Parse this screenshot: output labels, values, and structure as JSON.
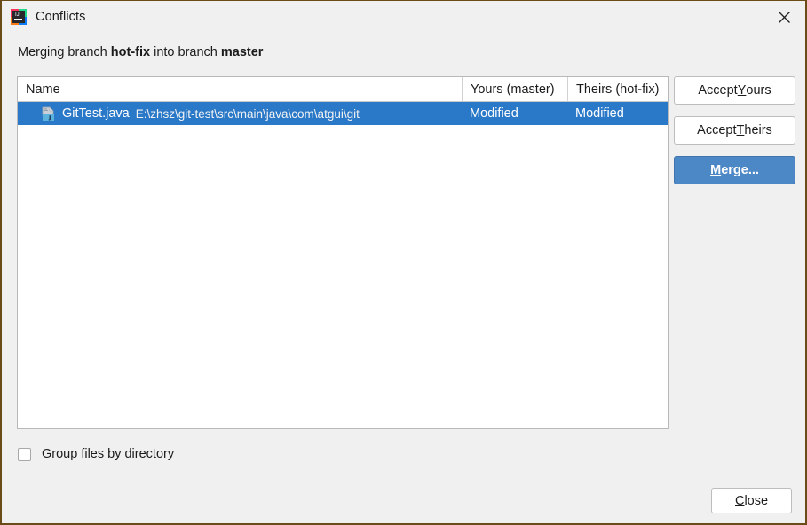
{
  "window": {
    "title": "Conflicts",
    "app_icon": "intellij-idea-icon",
    "close_icon": "close-icon",
    "border_color": "#6b4b18",
    "background": "#f0f0f0"
  },
  "subtitle": {
    "prefix": "Merging branch ",
    "source_branch": "hot-fix",
    "middle": " into branch ",
    "target_branch": "master"
  },
  "table": {
    "columns": [
      {
        "key": "name",
        "label": "Name"
      },
      {
        "key": "yours",
        "label": "Yours (master)"
      },
      {
        "key": "theirs",
        "label": "Theirs (hot-fix)"
      }
    ],
    "rows": [
      {
        "file_icon": "java-file-icon",
        "name": "GitTest.java",
        "path": "E:\\zhsz\\git-test\\src\\main\\java\\com\\atgui\\git",
        "yours": "Modified",
        "theirs": "Modified",
        "selected": true
      }
    ],
    "selection_color": "#2a78c8"
  },
  "side_buttons": [
    {
      "name": "accept-yours-button",
      "pre": "Accept ",
      "mnemonic": "Y",
      "post": "ours",
      "primary": false
    },
    {
      "name": "accept-theirs-button",
      "pre": "Accept ",
      "mnemonic": "T",
      "post": "heirs",
      "primary": false
    },
    {
      "name": "merge-button",
      "pre": "",
      "mnemonic": "M",
      "post": "erge...",
      "primary": true
    }
  ],
  "group_checkbox": {
    "label": "Group files by directory",
    "checked": false
  },
  "close_button": {
    "mnemonic": "C",
    "post": "lose"
  }
}
